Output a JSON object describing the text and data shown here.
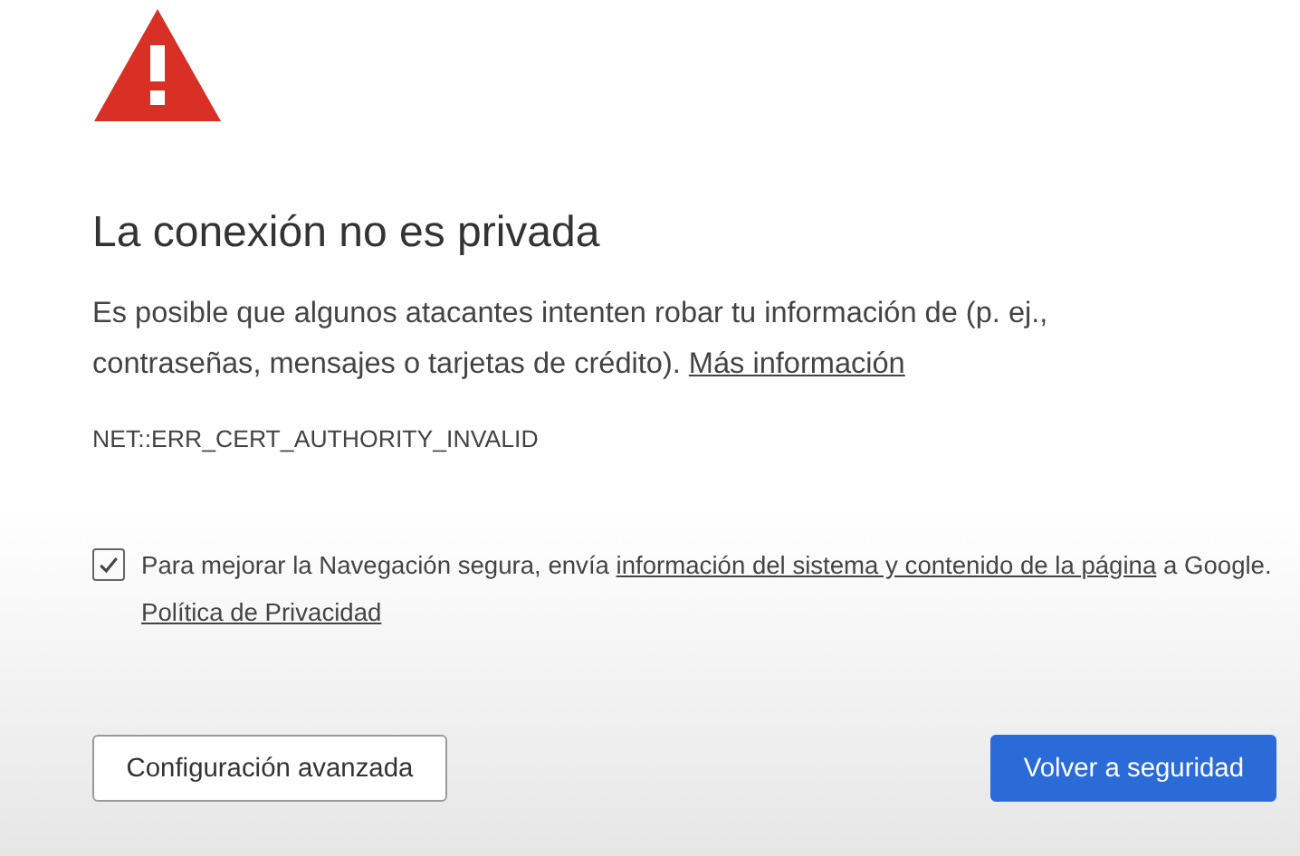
{
  "heading": "La conexión no es privada",
  "description": [
    {
      "text": "Es posible que algunos atacantes intenten robar tu información de (p. ej., contraseñas, mensajes o tarjetas de crédito). ",
      "link": false
    },
    {
      "text": "Más información",
      "link": true
    }
  ],
  "error_code": "NET::ERR_CERT_AUTHORITY_INVALID",
  "report_checkbox": {
    "checked": true,
    "parts": [
      {
        "text": "Para mejorar la Navegación segura, envía ",
        "link": false
      },
      {
        "text": "información del sistema y contenido de la página",
        "link": true
      },
      {
        "text": " a Google. ",
        "link": false
      },
      {
        "text": "Política de Privacidad",
        "link": true
      }
    ]
  },
  "buttons": [
    {
      "label": "Configuración avanzada",
      "kind": "secondary"
    },
    {
      "label": "Volver a seguridad",
      "kind": "primary"
    }
  ]
}
